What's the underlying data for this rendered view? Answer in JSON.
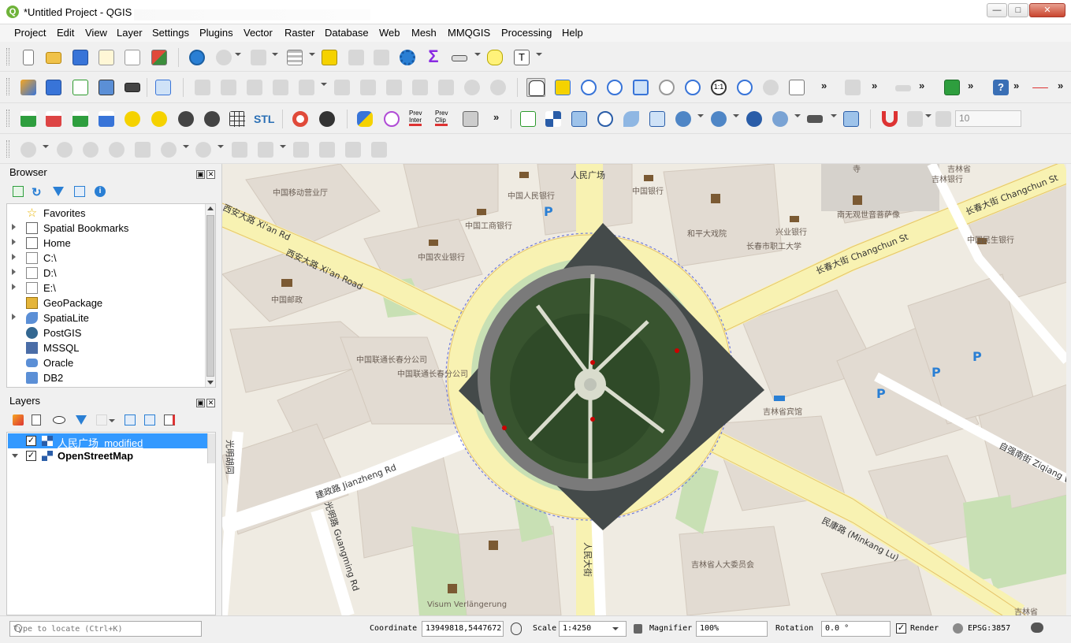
{
  "window": {
    "title": "*Untitled Project - QGIS",
    "app_icon": "qgis-icon",
    "controls": [
      "minimize",
      "maximize",
      "close"
    ]
  },
  "menubar": {
    "items": [
      "Project",
      "Edit",
      "View",
      "Layer",
      "Settings",
      "Plugins",
      "Vector",
      "Raster",
      "Database",
      "Web",
      "Mesh",
      "MMQGIS",
      "Processing",
      "Help"
    ]
  },
  "toolbars": {
    "overflow": "»",
    "row3_stl": "STL",
    "row3_prev_inter": "Prev\nInter",
    "row3_prev_clip": "Prev\nClip",
    "snapping_tolerance": "10",
    "colors": {
      "accent_blue": "#3874d8",
      "gear_blue": "#2a7fd4",
      "sigma_purple": "#8a2be2"
    }
  },
  "browser": {
    "title": "Browser",
    "items": [
      {
        "label": "Favorites",
        "icon": "star-icon",
        "expandable": false
      },
      {
        "label": "Spatial Bookmarks",
        "icon": "bookmark-icon",
        "expandable": true
      },
      {
        "label": "Home",
        "icon": "home-icon",
        "expandable": true
      },
      {
        "label": "C:\\",
        "icon": "folder-icon",
        "expandable": true
      },
      {
        "label": "D:\\",
        "icon": "folder-icon",
        "expandable": true
      },
      {
        "label": "E:\\",
        "icon": "folder-icon",
        "expandable": true
      },
      {
        "label": "GeoPackage",
        "icon": "geopackage-icon",
        "expandable": false
      },
      {
        "label": "SpatiaLite",
        "icon": "spatialite-icon",
        "expandable": true
      },
      {
        "label": "PostGIS",
        "icon": "postgis-icon",
        "expandable": false
      },
      {
        "label": "MSSQL",
        "icon": "mssql-icon",
        "expandable": false
      },
      {
        "label": "Oracle",
        "icon": "oracle-icon",
        "expandable": false
      },
      {
        "label": "DB2",
        "icon": "db2-icon",
        "expandable": false
      }
    ]
  },
  "layers": {
    "title": "Layers",
    "items": [
      {
        "label": "人民广场_modified",
        "checked": true,
        "selected": true,
        "bold": false
      },
      {
        "label": "OpenStreetMap",
        "checked": true,
        "selected": false,
        "bold": true
      }
    ]
  },
  "map": {
    "road_labels": [
      "西安大路 Xi'an Rd",
      "西安大路 Xi'an Road",
      "长春大街 Changchun St",
      "长春大街 Changchun St",
      "建政路 Jianzheng Rd",
      "光明胡同",
      "光明路 Guangming Rd",
      "民康路 (Minkang Lu)",
      "自强南街 Ziqiang W",
      "人民广场",
      "人民大街"
    ],
    "poi_labels": [
      "中国移动营业厅",
      "中国人民银行",
      "中国银行",
      "中国工商银行",
      "中国农业银行",
      "中国邮政",
      "和平大戏院",
      "长春市职工大学",
      "兴业银行",
      "南无观世音菩萨像",
      "中国民生银行",
      "吉林银行",
      "中国联通长春分公司",
      "中国联通长春分公司",
      "吉林省宾馆",
      "吉林省人大委员会",
      "Visum Verlängerung",
      "寺",
      "吉林省",
      "吉林省"
    ],
    "parking_label": "P"
  },
  "statusbar": {
    "locate_placeholder": "Type to locate (Ctrl+K)",
    "coordinate_label": "Coordinate",
    "coordinate_value": "13949818,5447672",
    "scale_label": "Scale",
    "scale_value": "1:4250",
    "magnifier_label": "Magnifier",
    "magnifier_value": "100%",
    "rotation_label": "Rotation",
    "rotation_value": "0.0 °",
    "render_label": "Render",
    "render_checked": true,
    "crs_label": "EPSG:3857"
  }
}
